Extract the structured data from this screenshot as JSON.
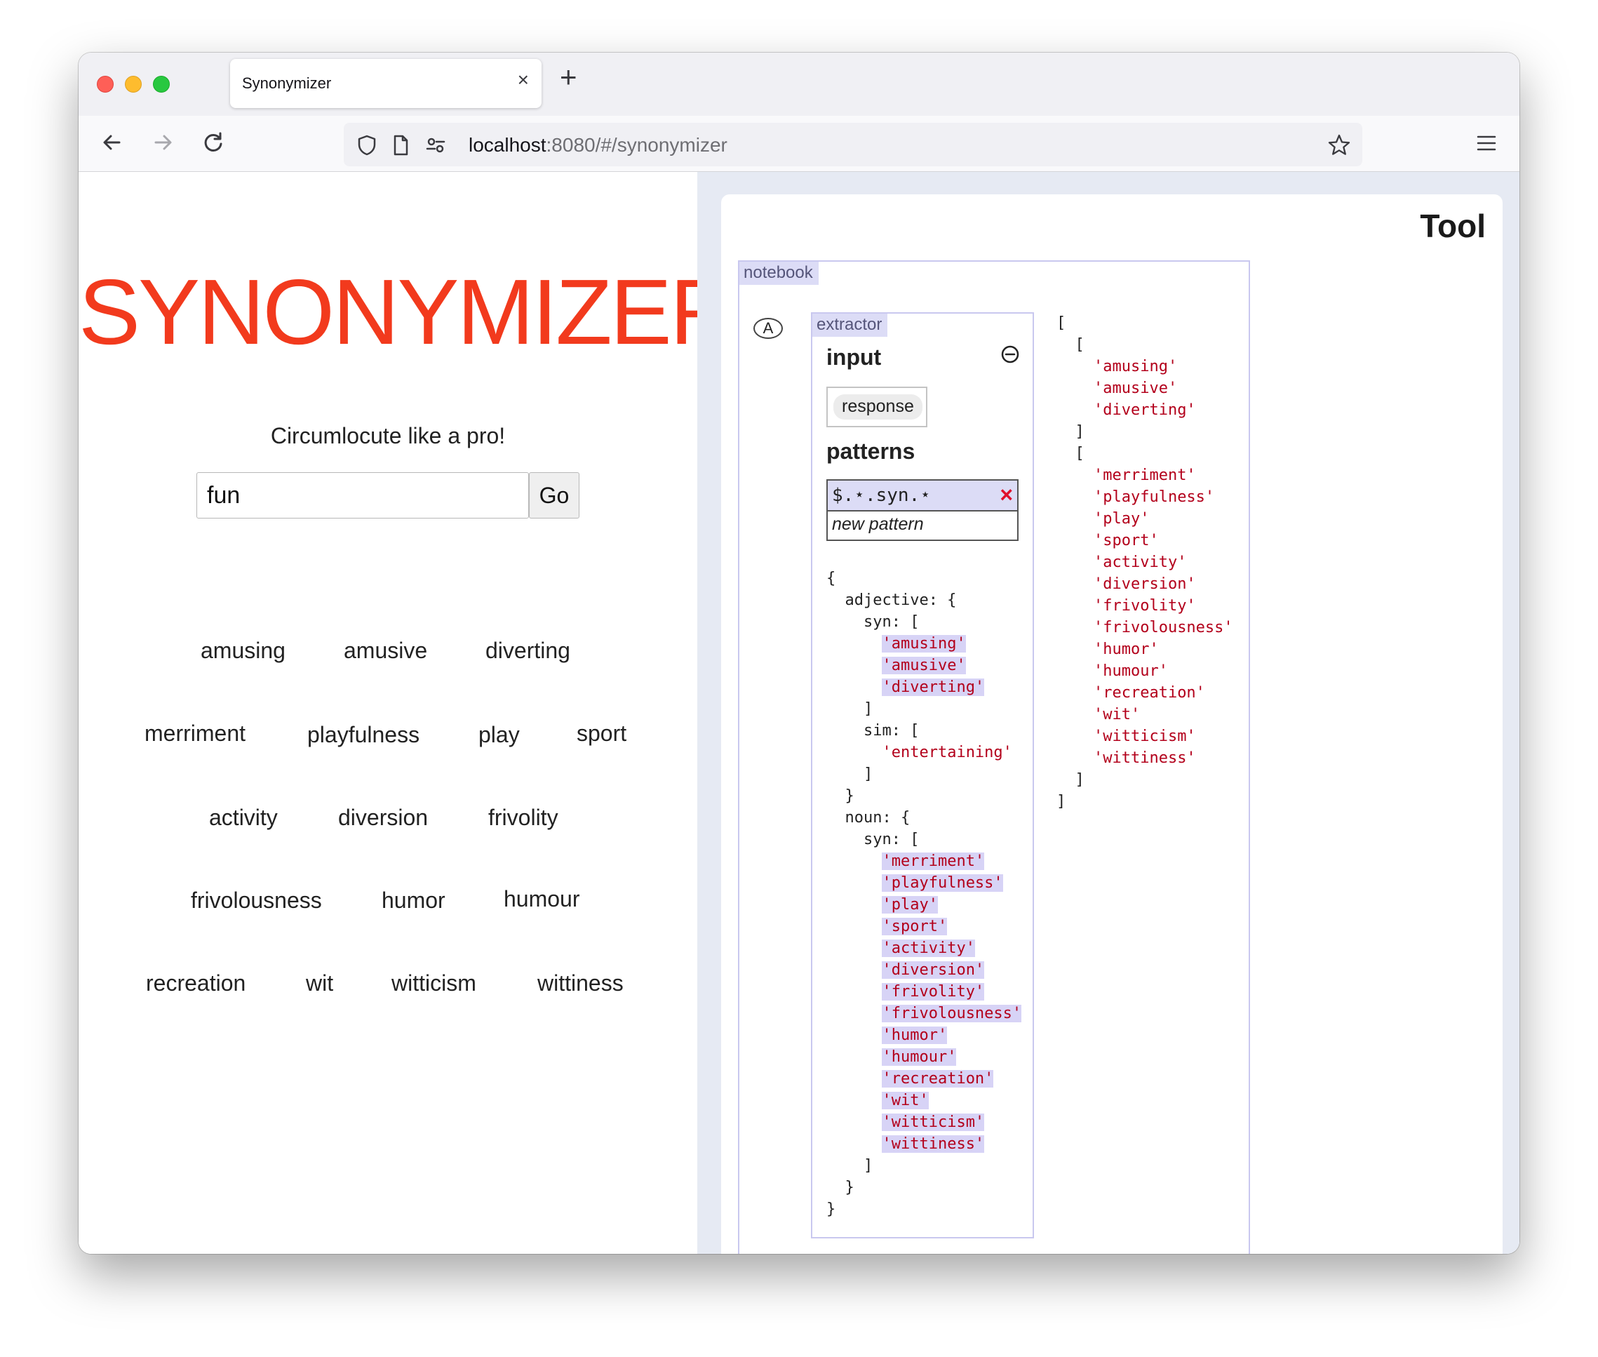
{
  "browser": {
    "tab_title": "Synonymizer",
    "tab_close": "×",
    "new_tab": "+",
    "url_host": "localhost",
    "url_rest": ":8080/#/synonymizer"
  },
  "app": {
    "title": "SYNONYMIZER",
    "tagline": "Circumlocute like a pro!",
    "search_value": "fun",
    "go_label": "Go",
    "results": [
      "amusing",
      "amusive",
      "diverting",
      "merriment",
      "playfulness",
      "play",
      "sport",
      "activity",
      "diversion",
      "frivolity",
      "frivolousness",
      "humor",
      "humour",
      "recreation",
      "wit",
      "witticism",
      "wittiness"
    ]
  },
  "tool": {
    "title": "Tool",
    "notebook_label": "notebook",
    "cell_label": "A",
    "extractor_label": "extractor",
    "input_heading": "input",
    "input_source": "response",
    "patterns_heading": "patterns",
    "patterns": [
      "$.⋆.syn.⋆"
    ],
    "pattern_delete": "×",
    "new_pattern_placeholder": "new pattern",
    "response": {
      "adjective_syn": [
        "amusing",
        "amusive",
        "diverting"
      ],
      "adjective_sim": [
        "entertaining"
      ],
      "noun_syn": [
        "merriment",
        "playfulness",
        "play",
        "sport",
        "activity",
        "diversion",
        "frivolity",
        "frivolousness",
        "humor",
        "humour",
        "recreation",
        "wit",
        "witticism",
        "wittiness"
      ]
    },
    "output": [
      [
        "amusing",
        "amusive",
        "diverting"
      ],
      [
        "merriment",
        "playfulness",
        "play",
        "sport",
        "activity",
        "diversion",
        "frivolity",
        "frivolousness",
        "humor",
        "humour",
        "recreation",
        "wit",
        "witticism",
        "wittiness"
      ]
    ]
  }
}
